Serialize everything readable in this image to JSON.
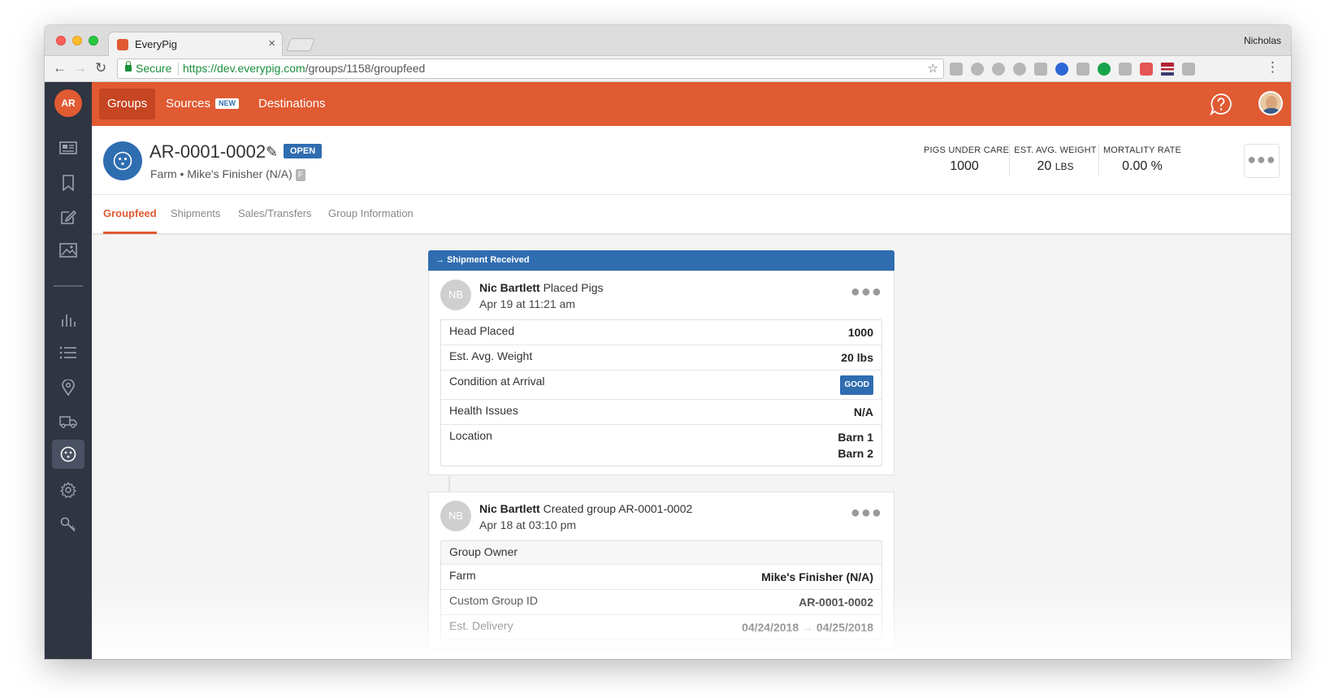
{
  "browser": {
    "tab_title": "EveryPig",
    "tab_close": "×",
    "profile_name": "Nicholas",
    "secure_label": "Secure",
    "url_host": "https://dev.everypig.com",
    "url_path": "/groups/1158/groupfeed"
  },
  "sidebar": {
    "avatar_initials": "AR"
  },
  "topnav": {
    "items": [
      {
        "label": "Groups"
      },
      {
        "label": "Sources",
        "badge": "NEW"
      },
      {
        "label": "Destinations"
      }
    ]
  },
  "group": {
    "title": "AR-0001-0002",
    "status": "OPEN",
    "subtitle": "Farm • Mike's Finisher (N/A)",
    "farm_type": "F",
    "stats": [
      {
        "label": "PIGS UNDER CARE",
        "value": "1000",
        "unit": ""
      },
      {
        "label": "EST. AVG. WEIGHT",
        "value": "20",
        "unit": "LBS"
      },
      {
        "label": "MORTALITY RATE",
        "value": "0.00 %",
        "unit": ""
      }
    ]
  },
  "tabs": [
    "Groupfeed",
    "Shipments",
    "Sales/Transfers",
    "Group Information"
  ],
  "feed": {
    "banner": "Shipment Received",
    "cards": [
      {
        "initials": "NB",
        "author": "Nic Bartlett",
        "action": "Placed Pigs",
        "time": "Apr 19 at 11:21 am",
        "rows": [
          {
            "label": "Head Placed",
            "value": "1000"
          },
          {
            "label": "Est. Avg. Weight",
            "value": "20 lbs"
          },
          {
            "label": "Condition at Arrival",
            "value": "GOOD"
          },
          {
            "label": "Health Issues",
            "value": "N/A"
          },
          {
            "label": "Location",
            "values": [
              "Barn 1",
              "Barn 2"
            ]
          }
        ]
      },
      {
        "initials": "NB",
        "author": "Nic Bartlett",
        "action": "Created group AR-0001-0002",
        "time": "Apr 18 at 03:10 pm",
        "rows": [
          {
            "label": "Group Owner",
            "value": ""
          },
          {
            "label": "Farm",
            "value": "Mike's Finisher (N/A)"
          },
          {
            "label": "Custom Group ID",
            "value": "AR-0001-0002"
          },
          {
            "label": "Est. Delivery",
            "value_from": "04/24/2018",
            "value_arrow": "→",
            "value_to": "04/25/2018"
          }
        ]
      }
    ]
  },
  "colors": {
    "brand_orange": "#e05a32",
    "brand_blue": "#2f6db1",
    "sidebar_dark": "#2f3541"
  }
}
